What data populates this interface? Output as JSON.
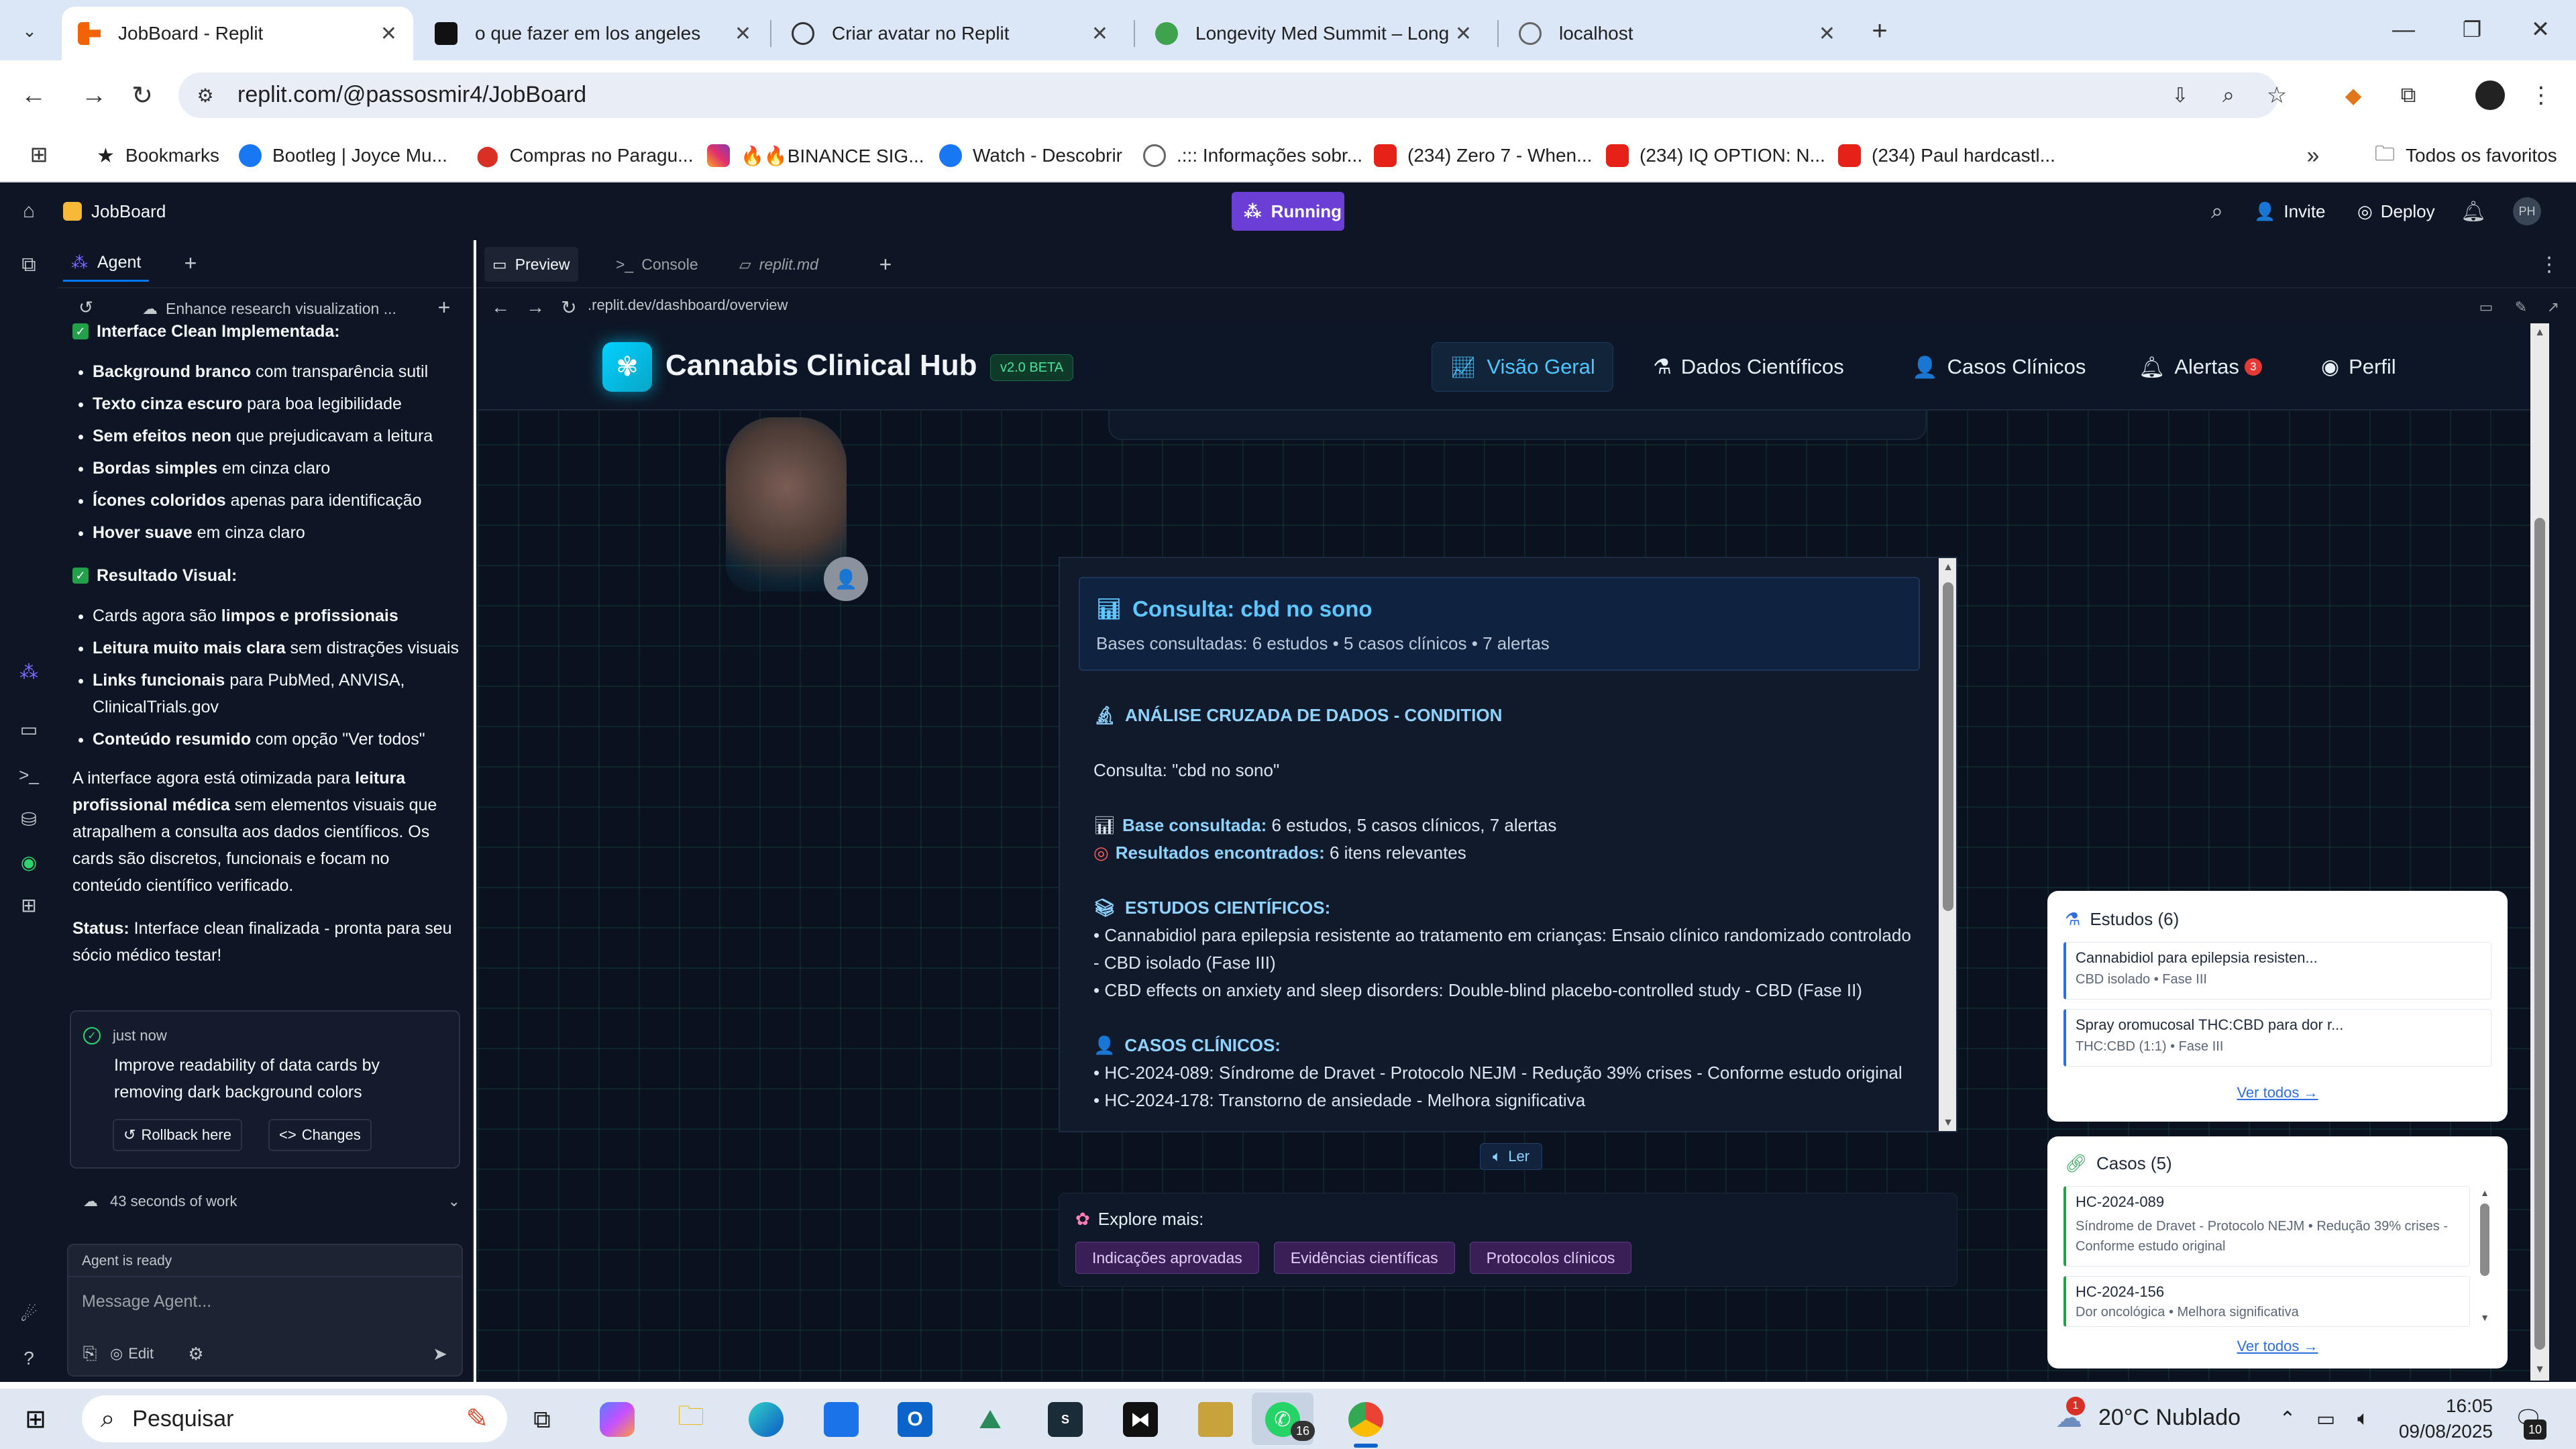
{
  "browser": {
    "tabs": [
      {
        "title": "JobBoard - Replit",
        "active": true
      },
      {
        "title": "o que fazer em los angeles"
      },
      {
        "title": "Criar avatar no Replit"
      },
      {
        "title": "Longevity Med Summit – Longe"
      },
      {
        "title": "localhost"
      }
    ],
    "url": "replit.com/@passosmir4/JobBoard",
    "bookmarks": [
      "Bookmarks",
      "Bootleg | Joyce Mu...",
      "Compras no Paragu...",
      "🔥🔥BINANCE SIG...",
      "Watch - Descobrir",
      ".::: Informações sobr...",
      "(234) Zero 7 - When...",
      "(234) IQ OPTION: N...",
      "(234) Paul hardcastl..."
    ],
    "all_favorites": "Todos os favoritos"
  },
  "replit": {
    "project": "JobBoard",
    "status": "Running",
    "invite": "Invite",
    "deploy": "Deploy",
    "avatar_initials": "PH",
    "agent_tab": "Agent",
    "thread_title": "Enhance research visualization ...",
    "heading1": "Interface Clean Implementada:",
    "list1": [
      {
        "b": "Background branco",
        "t": " com transparência sutil"
      },
      {
        "b": "Texto cinza escuro",
        "t": " para boa legibilidade"
      },
      {
        "b": "Sem efeitos neon",
        "t": " que prejudicavam a leitura"
      },
      {
        "b": "Bordas simples",
        "t": " em cinza claro"
      },
      {
        "b": "Ícones coloridos",
        "t": " apenas para identificação"
      },
      {
        "b": "Hover suave",
        "t": " em cinza claro"
      }
    ],
    "heading2": "Resultado Visual:",
    "list2": [
      {
        "a": "Cards agora são ",
        "b": "limpos e profissionais",
        "t": ""
      },
      {
        "a": "",
        "b": "Leitura muito mais clara",
        "t": " sem distrações visuais"
      },
      {
        "a": "",
        "b": "Links funcionais",
        "t": " para PubMed, ANVISA, ClinicalTrials.gov"
      },
      {
        "a": "",
        "b": "Conteúdo resumido",
        "t": " com opção \"Ver todos\""
      }
    ],
    "para_a": "A interface agora está otimizada para ",
    "para_b": "leitura profissional médica",
    "para_c": " sem elementos visuais que atrapalhem a consulta aos dados científicos. Os cards são discretos, funcionais e focam no conteúdo científico verificado.",
    "status_label": "Status:",
    "status_text": " Interface clean finalizada - pronta para seu sócio médico testar!",
    "checkpoint_time": "just now",
    "checkpoint_msg": "Improve readability of data cards by removing dark background colors",
    "rollback": "Rollback here",
    "changes": "Changes",
    "work_time": "43 seconds of work",
    "agent_ready": "Agent is ready",
    "message_placeholder": "Message Agent...",
    "edit": "Edit",
    "tabs": [
      "Preview",
      "Console",
      "replit.md"
    ],
    "preview_url": ".replit.dev/dashboard/overview"
  },
  "app": {
    "brand": "Cannabis Clinical Hub",
    "version": "v2.0 BETA",
    "nav": [
      "Visão Geral",
      "Dados Científicos",
      "Casos Clínicos",
      "Alertas",
      "Perfil"
    ],
    "alerts_count": "3",
    "query_title": "Consulta: cbd no sono",
    "query_sub": "Bases consultadas: 6 estudos • 5 casos clínicos • 7 alertas",
    "analysis_heading": "ANÁLISE CRUZADA DE DADOS - CONDITION",
    "consulta_line": "Consulta: \"cbd no sono\"",
    "base_label": "Base consultada:",
    "base_value": " 6 estudos, 5 casos clínicos, 7 alertas",
    "results_label": "Resultados encontrados:",
    "results_value": " 6 itens relevantes",
    "studies_heading": "ESTUDOS CIENTÍFICOS:",
    "studies": [
      "• Cannabidiol para epilepsia resistente ao tratamento em crianças: Ensaio clínico randomizado controlado - CBD isolado (Fase III)",
      "• CBD effects on anxiety and sleep disorders: Double-blind placebo-controlled study - CBD (Fase II)"
    ],
    "cases_heading": "CASOS CLÍNICOS:",
    "cases": [
      "• HC-2024-089: Síndrome de Dravet - Protocolo NEJM - Redução 39% crises - Conforme estudo original",
      "• HC-2024-178: Transtorno de ansiedade - Melhora significativa"
    ],
    "read_btn": "Ler",
    "explore_label": "Explore mais:",
    "explore_pills": [
      "Indicações aprovadas",
      "Evidências científicas",
      "Protocolos clínicos"
    ],
    "studies_card": {
      "title": "Estudos (6)",
      "items": [
        {
          "title": "Cannabidiol para epilepsia resisten...",
          "meta": "CBD isolado • Fase III"
        },
        {
          "title": "Spray oromucosal THC:CBD para dor r...",
          "meta": "THC:CBD (1:1) • Fase III"
        }
      ],
      "see_all": "Ver todos →"
    },
    "cases_card": {
      "title": "Casos (5)",
      "items": [
        {
          "title": "HC-2024-089",
          "meta": "Síndrome de Dravet - Protocolo NEJM • Redução 39% crises - Conforme estudo original"
        },
        {
          "title": "HC-2024-156",
          "meta": "Dor oncológica • Melhora significativa"
        }
      ],
      "see_all": "Ver todos →"
    }
  },
  "taskbar": {
    "search": "Pesquisar",
    "weather": "20°C  Nublado",
    "time": "16:05",
    "date": "09/08/2025",
    "whatsapp_badge": "16",
    "notif_badge": "10",
    "weather_badge": "1"
  }
}
